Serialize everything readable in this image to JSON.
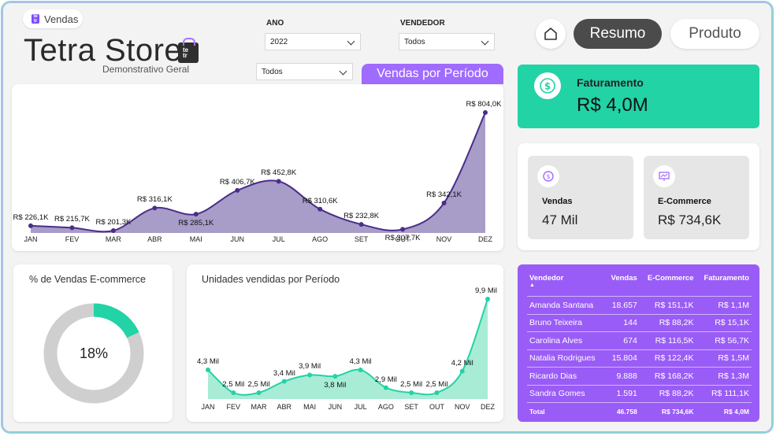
{
  "header": {
    "page_pill": "Vendas",
    "brand": "Tetra Store",
    "subtitle": "Demonstrativo Geral",
    "logo_text": "te\ntr\na"
  },
  "filters": {
    "ano": {
      "label": "ANO",
      "value": "2022"
    },
    "vendedor": {
      "label": "VENDEDOR",
      "value": "Todos"
    },
    "extra": {
      "value": "Todos"
    }
  },
  "nav": {
    "home_icon": "home-icon",
    "resumo": "Resumo",
    "produto": "Produto"
  },
  "colors": {
    "teal": "#22d3a6",
    "purple": "#9a5cf7",
    "line_purple": "#4b2d8a",
    "area_purple": "#a89cc8",
    "area_teal": "#a8ecd6"
  },
  "period_tab": "Vendas por Período",
  "chart_data": [
    {
      "type": "area",
      "title": "Vendas por Período",
      "categories": [
        "JAN",
        "FEV",
        "MAR",
        "ABR",
        "MAI",
        "JUN",
        "JUL",
        "AGO",
        "SET",
        "OUT",
        "NOV",
        "DEZ"
      ],
      "values": [
        226.1,
        215.7,
        201.3,
        316.1,
        285.1,
        406.7,
        452.8,
        310.6,
        232.8,
        207.7,
        342.1,
        804.0
      ],
      "labels": [
        "R$ 226,1K",
        "R$ 215,7K",
        "R$ 201,3K",
        "R$ 316,1K",
        "R$ 285,1K",
        "R$ 406,7K",
        "R$ 452,8K",
        "R$ 310,6K",
        "R$ 232,8K",
        "R$ 207,7K",
        "R$ 342,1K",
        "R$ 804,0K"
      ],
      "unit": "R$ K"
    },
    {
      "type": "pie",
      "title": "% de Vendas E-commerce",
      "values": [
        18,
        82
      ],
      "center_label": "18%"
    },
    {
      "type": "area",
      "title": "Unidades vendidas por Período",
      "categories": [
        "JAN",
        "FEV",
        "MAR",
        "ABR",
        "MAI",
        "JUN",
        "JUL",
        "AGO",
        "SET",
        "OUT",
        "NOV",
        "DEZ"
      ],
      "values": [
        4.3,
        2.5,
        2.5,
        3.4,
        3.9,
        3.8,
        4.3,
        2.9,
        2.5,
        2.5,
        4.2,
        9.9
      ],
      "labels": [
        "4,3 Mil",
        "2,5 Mil",
        "2,5 Mil",
        "3,4 Mil",
        "3,9 Mil",
        "3,8 Mil",
        "4,3 Mil",
        "2,9 Mil",
        "2,5 Mil",
        "2,5 Mil",
        "4,2 Mil",
        "9,9 Mil"
      ],
      "unit": "Mil"
    }
  ],
  "kpis": {
    "faturamento": {
      "title": "Faturamento",
      "value": "R$ 4,0M",
      "icon": "dollar-icon"
    },
    "vendas": {
      "title": "Vendas",
      "value": "47 Mil",
      "icon": "sales-icon"
    },
    "ecommerce": {
      "title": "E-Commerce",
      "value": "R$ 734,6K",
      "icon": "ecommerce-icon"
    }
  },
  "table": {
    "headers": [
      "Vendedor",
      "Vendas",
      "E-Commerce",
      "Faturamento"
    ],
    "rows": [
      [
        "Amanda Santana",
        "18.657",
        "R$ 151,1K",
        "R$ 1,1M"
      ],
      [
        "Bruno Teixeira",
        "144",
        "R$ 88,2K",
        "R$ 15,1K"
      ],
      [
        "Carolina Alves",
        "674",
        "R$ 116,5K",
        "R$ 56,7K"
      ],
      [
        "Natalia Rodrigues",
        "15.804",
        "R$ 122,4K",
        "R$ 1,5M"
      ],
      [
        "Ricardo Dias",
        "9.888",
        "R$ 168,2K",
        "R$ 1,3M"
      ],
      [
        "Sandra Gomes",
        "1.591",
        "R$ 88,2K",
        "R$ 111,1K"
      ]
    ],
    "total": [
      "Total",
      "46.758",
      "R$ 734,6K",
      "R$ 4,0M"
    ]
  }
}
